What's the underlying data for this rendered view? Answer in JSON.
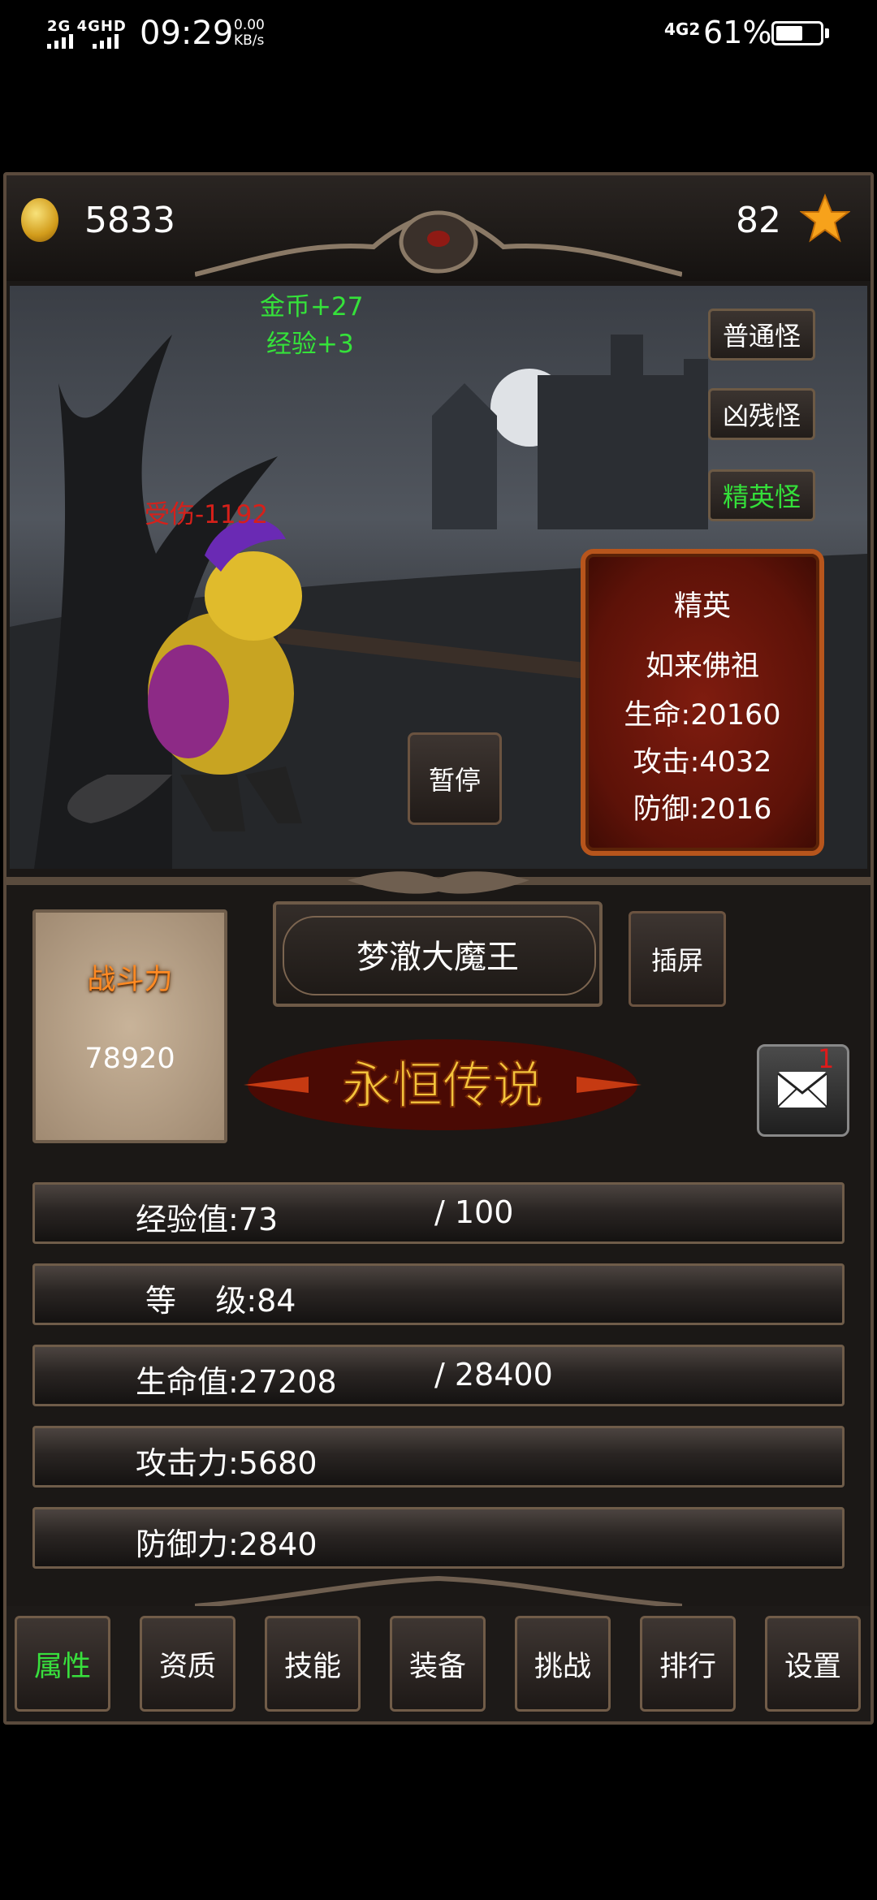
{
  "status_bar": {
    "network_left": "2G 4GHD",
    "time": "09:29",
    "speed_value": "0.00",
    "speed_unit": "KB/s",
    "network_right": "4G2",
    "battery_pct": "61%",
    "battery_level": 0.61
  },
  "header": {
    "coins": "5833",
    "stars": "82",
    "coin_icon": "gold-coin-icon",
    "star_icon": "star-icon"
  },
  "battle": {
    "gain_gold": "金币+27",
    "gain_exp": "经验+3",
    "damage": "受伤-1192",
    "pause_label": "暂停",
    "monster_types": [
      "普通怪",
      "凶残怪",
      "精英怪"
    ],
    "active_monster_type": 2,
    "monster": {
      "rank": "精英",
      "name": "如来佛祖",
      "hp": "生命:20160",
      "atk": "攻击:4032",
      "def": "防御:2016"
    }
  },
  "player": {
    "power_label": "战斗力",
    "power_value": "78920",
    "name": "梦澈大魔王",
    "cast_label": "插屏",
    "mail_count": "1",
    "mail_icon": "envelope-icon",
    "logo_text": "永恒传说"
  },
  "stats": [
    {
      "label": "经验值:73",
      "extra": "/ 100"
    },
    {
      "label": "等    级:84",
      "extra": ""
    },
    {
      "label": "生命值:27208",
      "extra": "/ 28400"
    },
    {
      "label": "攻击力:5680",
      "extra": ""
    },
    {
      "label": "防御力:2840",
      "extra": ""
    }
  ],
  "nav": {
    "items": [
      "属性",
      "资质",
      "技能",
      "装备",
      "挑战",
      "排行",
      "设置"
    ],
    "active": 0
  },
  "colors": {
    "active_green": "#38e03d",
    "damage_red": "#d6201a",
    "power_orange": "#ff8a23",
    "card_red": "#7f1c0f"
  }
}
